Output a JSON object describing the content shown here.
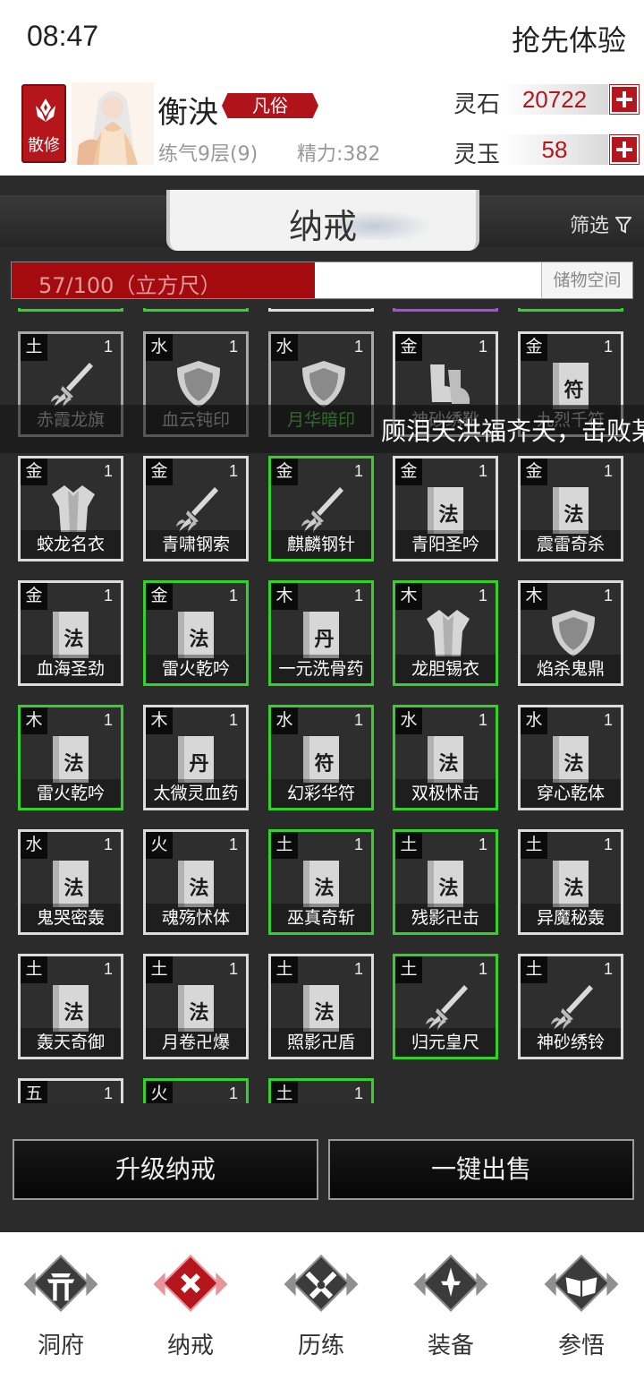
{
  "status": {
    "time": "08:47",
    "right_text": "抢先体验"
  },
  "player": {
    "sect": "散修",
    "name": "衡泱",
    "rank": "凡俗",
    "level": "练气9层(9)",
    "energy": "精力:382",
    "resources": [
      {
        "label": "灵石",
        "value": "20722"
      },
      {
        "label": "灵玉",
        "value": "58"
      }
    ]
  },
  "ring": {
    "title": "纳戒",
    "filter": "筛选",
    "capacity_text": "57/100（立方尺）",
    "capacity_fraction": 0.57,
    "storage_label": "储物空间"
  },
  "ticker": "顾泪天洪福齐天，击败某",
  "items": [
    {
      "el": "土",
      "qty": "1",
      "name": "赤霞龙旗",
      "icon": "sword",
      "border": "grey",
      "text_color": "#bdbdbd"
    },
    {
      "el": "水",
      "qty": "1",
      "name": "血云钝印",
      "icon": "shield",
      "border": "grey",
      "text_color": "#bdbdbd"
    },
    {
      "el": "水",
      "qty": "1",
      "name": "月华暗印",
      "icon": "shield",
      "border": "grey",
      "text_color": "#59d34a"
    },
    {
      "el": "金",
      "qty": "1",
      "name": "神砂绣靴",
      "icon": "boots",
      "border": "white",
      "text_color": "#bdbdbd"
    },
    {
      "el": "金",
      "qty": "1",
      "name": "九烈千符",
      "icon": "book",
      "glyph": "符",
      "border": "white",
      "text_color": "#bdbdbd"
    },
    {
      "el": "金",
      "qty": "1",
      "name": "蛟龙名衣",
      "icon": "robe",
      "border": "white"
    },
    {
      "el": "金",
      "qty": "1",
      "name": "青啸钢索",
      "icon": "sword",
      "border": "white"
    },
    {
      "el": "金",
      "qty": "1",
      "name": "麒麟钢针",
      "icon": "sword",
      "border": "green"
    },
    {
      "el": "金",
      "qty": "1",
      "name": "青阳圣吟",
      "icon": "book",
      "glyph": "法",
      "border": "white"
    },
    {
      "el": "金",
      "qty": "1",
      "name": "震雷奇杀",
      "icon": "book",
      "glyph": "法",
      "border": "white"
    },
    {
      "el": "金",
      "qty": "1",
      "name": "血海圣劲",
      "icon": "book",
      "glyph": "法",
      "border": "white"
    },
    {
      "el": "金",
      "qty": "1",
      "name": "雷火乾吟",
      "icon": "book",
      "glyph": "法",
      "border": "green"
    },
    {
      "el": "木",
      "qty": "1",
      "name": "一元洗骨药",
      "icon": "book",
      "glyph": "丹",
      "border": "green"
    },
    {
      "el": "木",
      "qty": "1",
      "name": "龙胆锡衣",
      "icon": "robe",
      "border": "green"
    },
    {
      "el": "木",
      "qty": "1",
      "name": "焰杀鬼鼎",
      "icon": "shield",
      "border": "white"
    },
    {
      "el": "木",
      "qty": "1",
      "name": "雷火乾吟",
      "icon": "book",
      "glyph": "法",
      "border": "green"
    },
    {
      "el": "木",
      "qty": "1",
      "name": "太微灵血药",
      "icon": "book",
      "glyph": "丹",
      "border": "white"
    },
    {
      "el": "水",
      "qty": "1",
      "name": "幻彩华符",
      "icon": "book",
      "glyph": "符",
      "border": "green"
    },
    {
      "el": "水",
      "qty": "1",
      "name": "双极怵击",
      "icon": "book",
      "glyph": "法",
      "border": "green"
    },
    {
      "el": "水",
      "qty": "1",
      "name": "穿心乾体",
      "icon": "book",
      "glyph": "法",
      "border": "white"
    },
    {
      "el": "水",
      "qty": "1",
      "name": "鬼哭密轰",
      "icon": "book",
      "glyph": "法",
      "border": "white"
    },
    {
      "el": "火",
      "qty": "1",
      "name": "魂殇怵体",
      "icon": "book",
      "glyph": "法",
      "border": "white"
    },
    {
      "el": "土",
      "qty": "1",
      "name": "巫真奇斩",
      "icon": "book",
      "glyph": "法",
      "border": "green"
    },
    {
      "el": "土",
      "qty": "1",
      "name": "残影卍击",
      "icon": "book",
      "glyph": "法",
      "border": "green"
    },
    {
      "el": "土",
      "qty": "1",
      "name": "异魔秘轰",
      "icon": "book",
      "glyph": "法",
      "border": "white"
    },
    {
      "el": "土",
      "qty": "1",
      "name": "轰天奇御",
      "icon": "book",
      "glyph": "法",
      "border": "white"
    },
    {
      "el": "土",
      "qty": "1",
      "name": "月卷卍爆",
      "icon": "book",
      "glyph": "法",
      "border": "white"
    },
    {
      "el": "土",
      "qty": "1",
      "name": "照影卍盾",
      "icon": "book",
      "glyph": "法",
      "border": "white"
    },
    {
      "el": "土",
      "qty": "1",
      "name": "归元皇尺",
      "icon": "sword",
      "border": "green"
    },
    {
      "el": "土",
      "qty": "1",
      "name": "神砂绣铃",
      "icon": "sword",
      "border": "white"
    },
    {
      "el": "五",
      "qty": "1",
      "name": "",
      "icon": "none",
      "border": "white"
    },
    {
      "el": "火",
      "qty": "1",
      "name": "",
      "icon": "none",
      "border": "green"
    },
    {
      "el": "土",
      "qty": "1",
      "name": "",
      "icon": "none",
      "border": "green"
    }
  ],
  "top_partial_borders": [
    "green",
    "green",
    "white",
    "purple",
    "green"
  ],
  "buttons": {
    "upgrade": "升级纳戒",
    "sell_all": "一键出售"
  },
  "nav": [
    {
      "label": "洞府",
      "icon": "cave-gate-icon",
      "active": false
    },
    {
      "label": "纳戒",
      "icon": "ring-x-icon",
      "active": true
    },
    {
      "label": "历练",
      "icon": "crossed-swords-icon",
      "active": false
    },
    {
      "label": "装备",
      "icon": "dagger-icon",
      "active": false
    },
    {
      "label": "参悟",
      "icon": "open-book-icon",
      "active": false
    }
  ],
  "colors": {
    "accent": "#b4161b",
    "green_border": "#34d12a",
    "purple_border": "#a54ee0",
    "dark_bg": "#2b2b2b"
  }
}
